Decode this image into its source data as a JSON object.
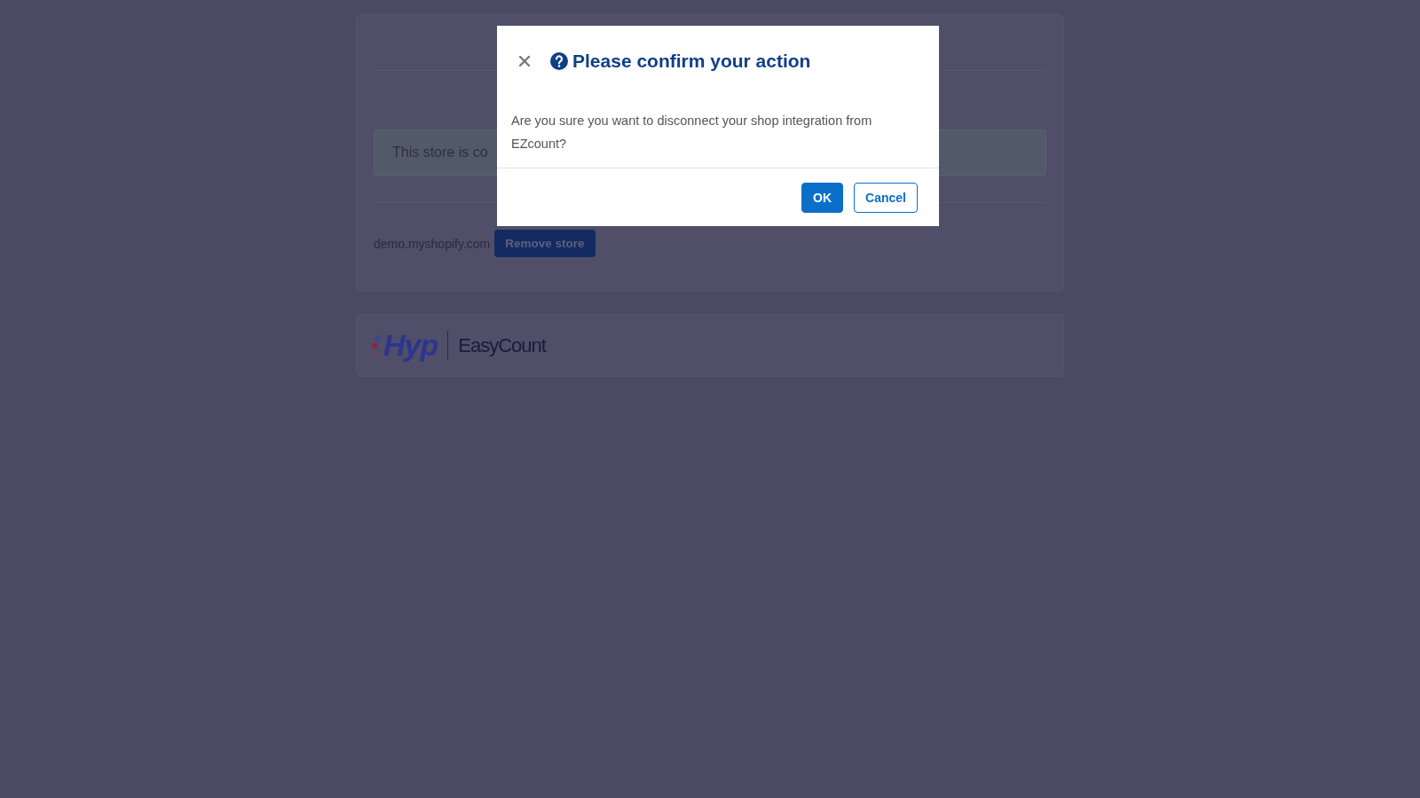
{
  "store_card": {
    "alert": "This store is co",
    "store_domain": "demo.myshopify.com",
    "remove_button": "Remove store"
  },
  "footer_logo": {
    "brand": "Hyp",
    "product": "EasyCount"
  },
  "dialog": {
    "title": "Please confirm your action",
    "message": "Are you sure you want to disconnect your shop integration from EZcount?",
    "buttons": [
      {
        "label": "OK",
        "kind": "primary"
      },
      {
        "label": "Cancel",
        "kind": "secondary"
      }
    ]
  }
}
